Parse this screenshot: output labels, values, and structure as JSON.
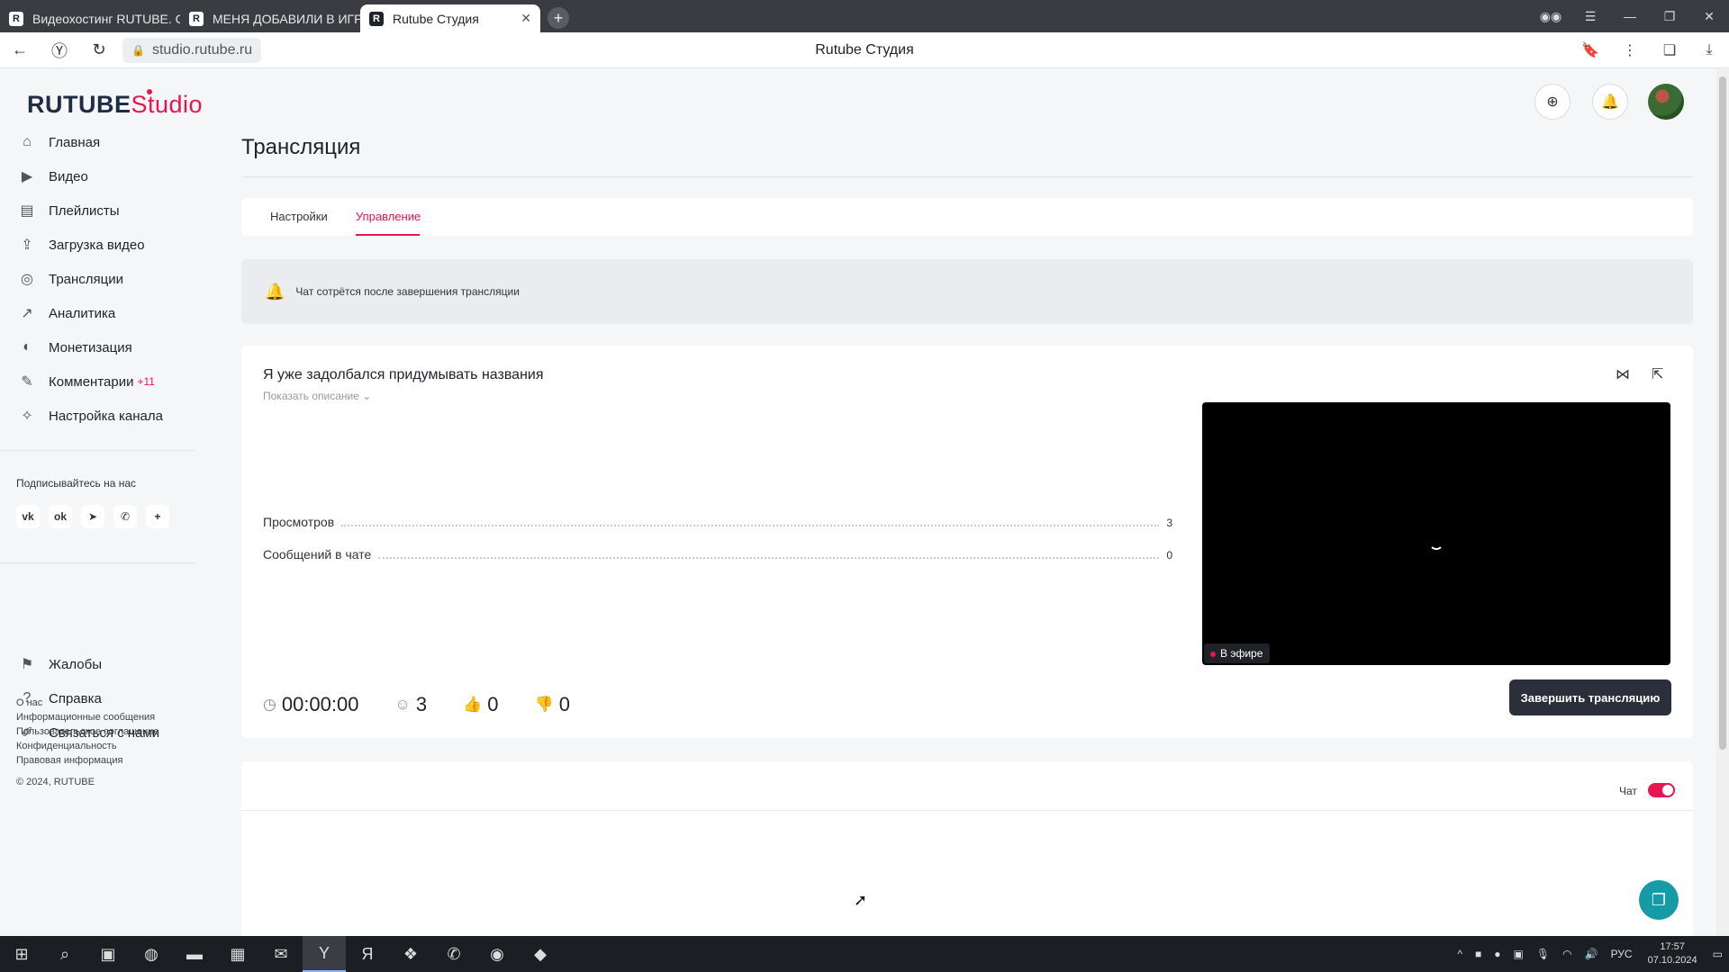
{
  "browser": {
    "tabs": [
      {
        "favicon": "R",
        "title": "Видеохостинг RUTUBE. С"
      },
      {
        "favicon": "R",
        "title": "МЕНЯ ДОБАВИЛИ В ИГР"
      },
      {
        "favicon": "R",
        "title": "Rutube Студия"
      }
    ],
    "url": "studio.rutube.ru",
    "page_title": "Rutube Студия"
  },
  "logo": {
    "rutube": "RUTUBE",
    "studio": "Studio"
  },
  "sidebar": {
    "items": [
      {
        "label": "Главная",
        "icon": "home-icon"
      },
      {
        "label": "Видео",
        "icon": "video-icon"
      },
      {
        "label": "Плейлисты",
        "icon": "playlist-icon"
      },
      {
        "label": "Загрузка видео",
        "icon": "upload-icon"
      },
      {
        "label": "Трансляции",
        "icon": "broadcast-icon"
      },
      {
        "label": "Аналитика",
        "icon": "analytics-icon"
      },
      {
        "label": "Монетизация",
        "icon": "money-icon"
      },
      {
        "label": "Комментарии",
        "badge": "+11",
        "icon": "comments-icon"
      },
      {
        "label": "Настройка канала",
        "icon": "wand-icon"
      }
    ],
    "subscribe_title": "Подписывайтесь на нас",
    "socials": [
      "vk",
      "ok",
      "telegram",
      "viber",
      "more"
    ],
    "secondary": [
      {
        "label": "Жалобы",
        "icon": "flag-icon"
      },
      {
        "label": "Справка",
        "icon": "help-icon"
      },
      {
        "label": "Связаться с нами",
        "icon": "edit-icon"
      }
    ],
    "footer_links": [
      "О нас",
      "Информационные сообщения",
      "Пользовательское соглашение",
      "Конфиденциальность",
      "Правовая информация"
    ],
    "copyright": "© 2024, RUTUBE"
  },
  "main": {
    "title": "Трансляция",
    "tabs": [
      {
        "label": "Настройки",
        "active": false
      },
      {
        "label": "Управление",
        "active": true
      }
    ],
    "notice": "Чат сотрётся после завершения трансляции",
    "stream": {
      "title": "Я уже задолбался придумывать названия",
      "show_description": "Показать описание",
      "stats": [
        {
          "label": "Просмотров",
          "value": "3"
        },
        {
          "label": "Сообщений в чате",
          "value": "0"
        }
      ],
      "duration": "00:00:00",
      "viewers": "3",
      "likes": "0",
      "dislikes": "0",
      "live_label": "В эфире",
      "end_button": "Завершить трансляцию"
    },
    "chat": {
      "label": "Чат",
      "enabled": true
    }
  },
  "taskbar": {
    "language": "РУС",
    "time": "17:57",
    "date": "07.10.2024"
  },
  "colors": {
    "accent": "#e8154f",
    "dark_button": "#2a2f3a",
    "support": "#159ba6"
  }
}
